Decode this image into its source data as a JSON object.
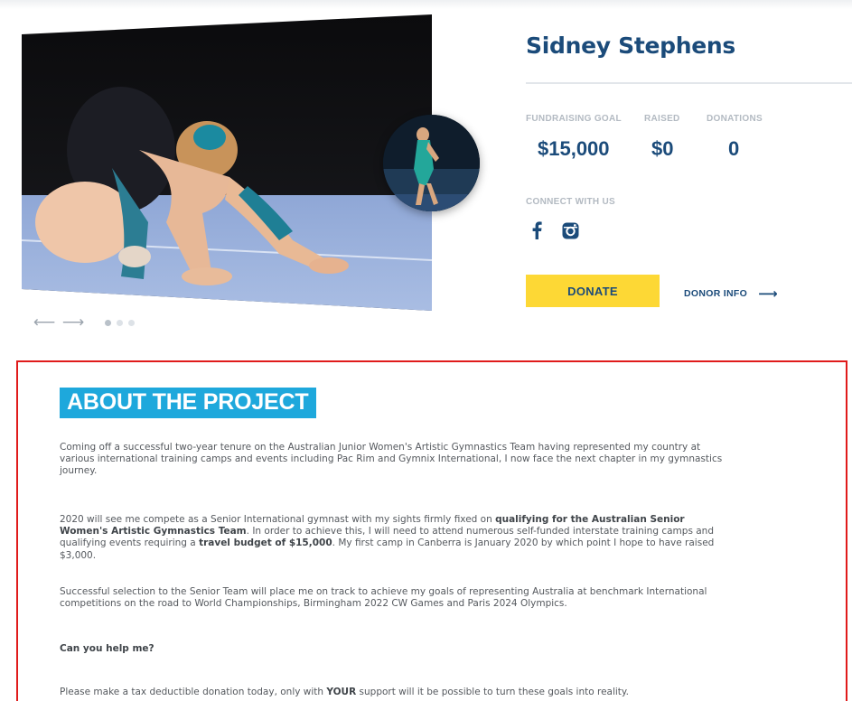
{
  "profile": {
    "name": "Sidney Stephens"
  },
  "stats": [
    {
      "label": "FUNDRAISING GOAL",
      "value": "$15,000"
    },
    {
      "label": "RAISED",
      "value": "$0"
    },
    {
      "label": "DONATIONS",
      "value": "0"
    }
  ],
  "connect": {
    "label": "CONNECT WITH US",
    "icons": [
      "facebook-icon",
      "instagram-icon"
    ]
  },
  "actions": {
    "donate_label": "DONATE",
    "donor_info_label": "DONOR INFO",
    "donor_info_arrow": "⟶"
  },
  "carousel": {
    "prev_arrow": "⟵",
    "next_arrow": "⟶",
    "slide_count": 3,
    "active_slide": 1
  },
  "about": {
    "title": "ABOUT THE PROJECT",
    "p1": "Coming off a successful two-year tenure on the Australian Junior Women's Artistic Gymnastics Team having represented my country at various international training camps and events including Pac Rim and Gymnix International, I now face the next chapter in my gymnastics journey.",
    "p2_a": "2020 will see me compete as a Senior International gymnast with my sights firmly fixed on ",
    "p2_b": "qualifying for the Australian Senior Women's Artistic Gymnastics Team",
    "p2_c": ". In order to achieve this, I will need to attend numerous self-funded interstate training camps and qualifying events requiring a ",
    "p2_d": "travel budget of $15,000",
    "p2_e": ". My first camp in Canberra is January 2020 by which point I hope to have raised $3,000.",
    "p3": "Successful selection to the Senior Team will place me on track to achieve my goals of representing Australia at benchmark International competitions on the road to World Championships, Birmingham 2022 CW Games and Paris 2024 Olympics.",
    "p4": "Can you help me?",
    "p5_a": "Please make a tax deductible donation today, only with ",
    "p5_b": "YOUR",
    "p5_c": " support will it be possible to turn these goals into reality."
  },
  "colors": {
    "brand_blue": "#1b4b7a",
    "accent_cyan": "#1ea8dc",
    "donate_yellow": "#fdd835",
    "highlight_border": "#e01b1b"
  }
}
